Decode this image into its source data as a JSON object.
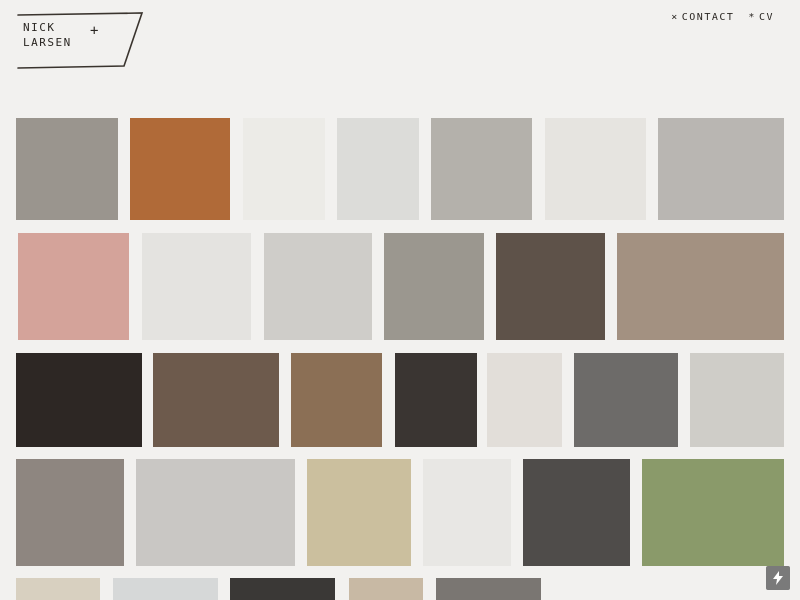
{
  "site": {
    "logo_line1": "NICK",
    "logo_line2": "LARSEN",
    "logo_plus": "+"
  },
  "nav": {
    "contact_star": "×",
    "contact_label": "CONTACT",
    "cv_star": "*",
    "cv_label": "CV"
  },
  "tiles": [
    {
      "name": "artwork-tile-dotted-landscape",
      "bg": "#9a958e"
    },
    {
      "name": "artwork-tile-wood-box",
      "bg": "#b06a38"
    },
    {
      "name": "artwork-tile-white-relief-text",
      "bg": "#ecebe7"
    },
    {
      "name": "artwork-tile-rock-photo",
      "bg": "#dcdcd9"
    },
    {
      "name": "artwork-tile-circles-landscape",
      "bg": "#b4b1ab"
    },
    {
      "name": "artwork-tile-mounted-photo",
      "bg": "#e6e4e0"
    },
    {
      "name": "artwork-tile-triangle-wall",
      "bg": "#b9b6b2"
    },
    {
      "name": "artwork-tile-pink-text",
      "bg": "#d4a39a"
    },
    {
      "name": "artwork-tile-white-sculpture",
      "bg": "#e4e3e0"
    },
    {
      "name": "artwork-tile-photo-grid",
      "bg": "#cfcdc9"
    },
    {
      "name": "artwork-tile-striped-collage",
      "bg": "#9b978f"
    },
    {
      "name": "artwork-tile-brown-paper",
      "bg": "#5e5249"
    },
    {
      "name": "artwork-tile-gallery-hall",
      "bg": "#a39181"
    },
    {
      "name": "artwork-tile-dark-installation",
      "bg": "#2d2724"
    },
    {
      "name": "artwork-tile-striped-wall",
      "bg": "#6d5a4c"
    },
    {
      "name": "artwork-tile-copper-triangles",
      "bg": "#8b6f55"
    },
    {
      "name": "artwork-tile-dark-collage",
      "bg": "#3a3532"
    },
    {
      "name": "artwork-tile-hand-house",
      "bg": "#e2ded9"
    },
    {
      "name": "artwork-tile-moire-pattern",
      "bg": "#6d6b69"
    },
    {
      "name": "artwork-tile-pale-map",
      "bg": "#cfcdc8"
    },
    {
      "name": "artwork-tile-geometric-face",
      "bg": "#8e8680"
    },
    {
      "name": "artwork-tile-gallery-white",
      "bg": "#c9c7c4"
    },
    {
      "name": "artwork-tile-gold-triangles",
      "bg": "#cbbf9e"
    },
    {
      "name": "artwork-tile-white-emboss",
      "bg": "#e8e7e4"
    },
    {
      "name": "artwork-tile-stripe-badge",
      "bg": "#4f4c4a"
    },
    {
      "name": "artwork-tile-bear-costume",
      "bg": "#8a9a6a"
    },
    {
      "name": "artwork-tile-bottom-1",
      "bg": "#d8d0c0"
    },
    {
      "name": "artwork-tile-bottom-2",
      "bg": "#d6d8d8"
    },
    {
      "name": "artwork-tile-bottom-3",
      "bg": "#3a3836"
    },
    {
      "name": "artwork-tile-bottom-4",
      "bg": "#c8b9a4"
    },
    {
      "name": "artwork-tile-bottom-5",
      "bg": "#7a7672"
    }
  ],
  "badge": {
    "icon": "lightning-icon"
  }
}
